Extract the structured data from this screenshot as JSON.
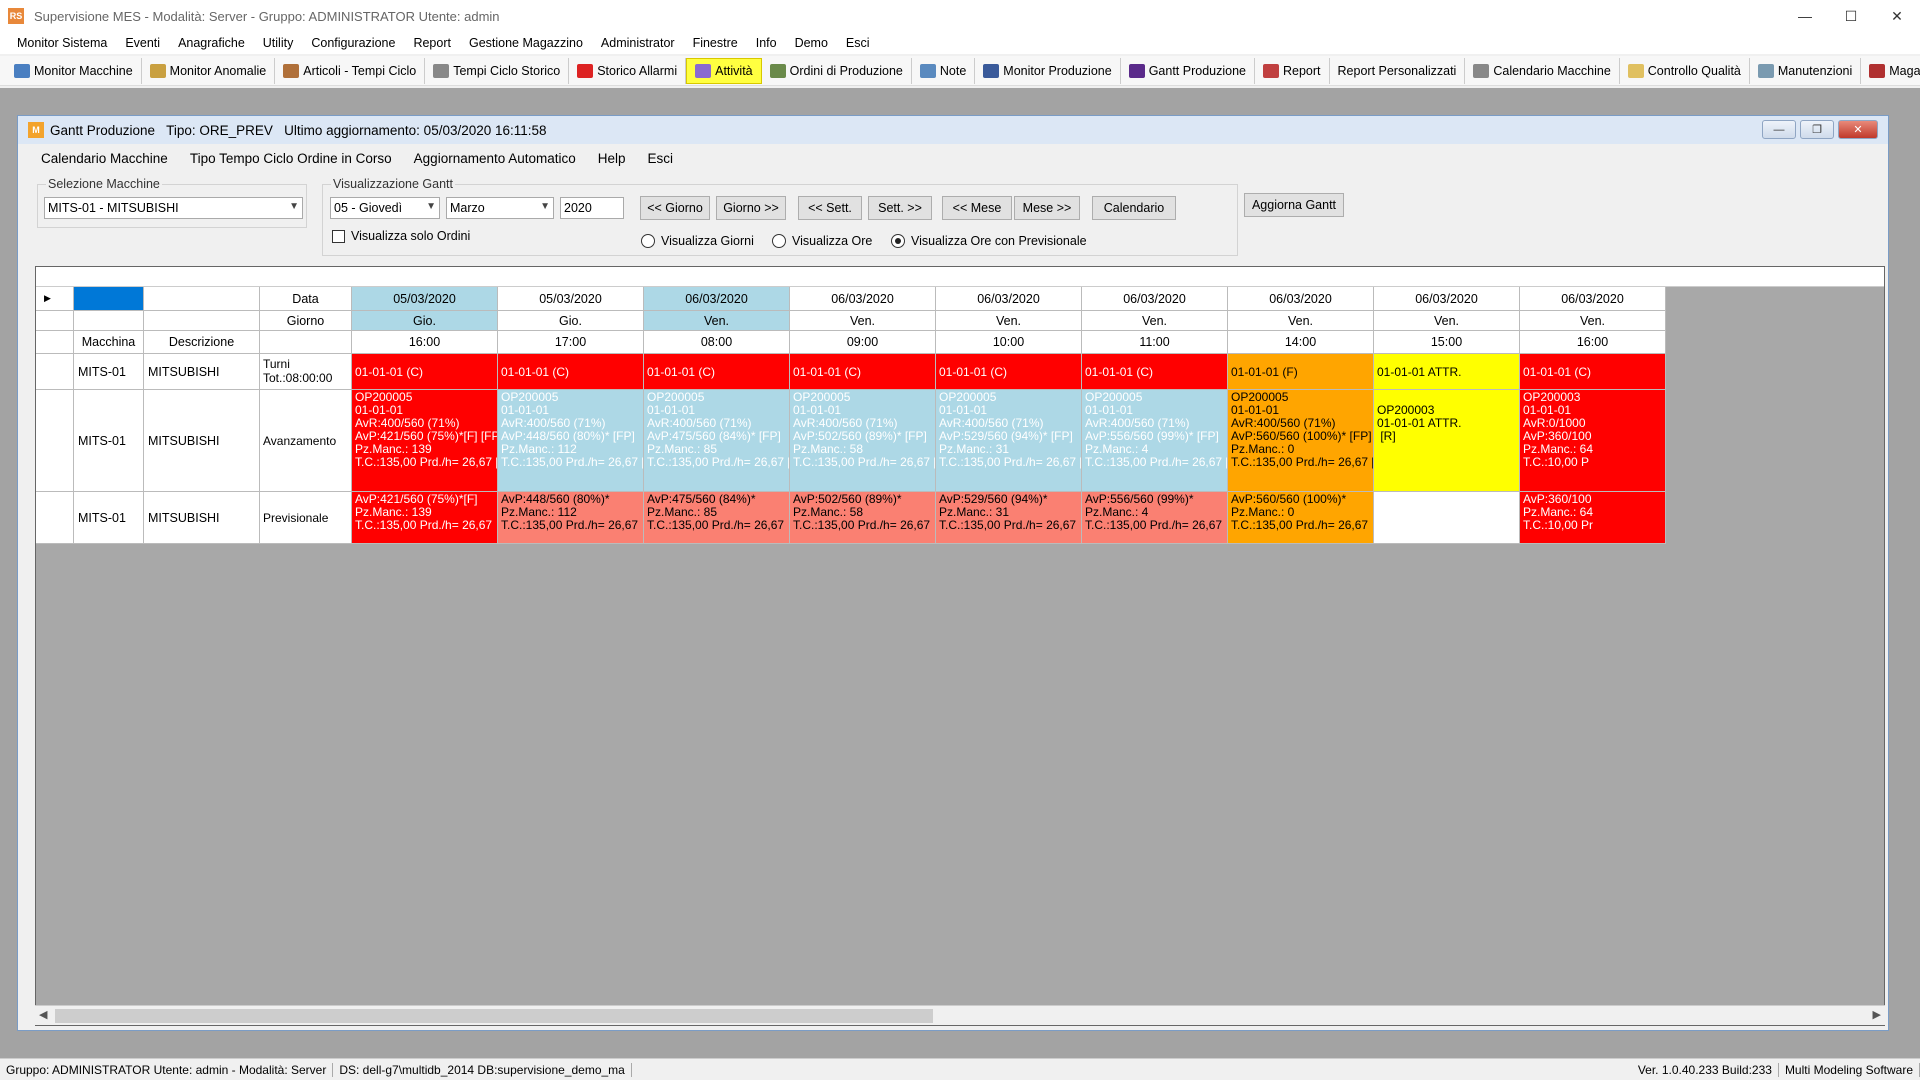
{
  "app": {
    "title": "Supervisione MES  -  Modalità: Server  -  Gruppo: ADMINISTRATOR  Utente: admin",
    "icon_text": "RS"
  },
  "menubar": [
    "Monitor Sistema",
    "Eventi",
    "Anagrafiche",
    "Utility",
    "Configurazione",
    "Report",
    "Gestione Magazzino",
    "Administrator",
    "Finestre",
    "Info",
    "Demo",
    "Esci"
  ],
  "toolbar": [
    {
      "label": "Monitor Macchine",
      "icon": "monitor-icon",
      "color": "#4a7fc1"
    },
    {
      "label": "Monitor Anomalie",
      "icon": "warning-car-icon",
      "color": "#c9a040"
    },
    {
      "label": "Articoli - Tempi Ciclo",
      "icon": "worker-icon",
      "color": "#b0703a"
    },
    {
      "label": "Tempi Ciclo Storico",
      "icon": "clock-icon",
      "color": "#888888"
    },
    {
      "label": "Storico Allarmi",
      "icon": "alarm-icon",
      "color": "#dd2222"
    },
    {
      "label": "Attività",
      "icon": "activity-icon",
      "color": "#8a6ad0",
      "active": true
    },
    {
      "label": "Ordini di Produzione",
      "icon": "orders-icon",
      "color": "#6a8a4a"
    },
    {
      "label": "Note",
      "icon": "note-icon",
      "color": "#5a8abf"
    },
    {
      "label": "Monitor Produzione",
      "icon": "screen-icon",
      "color": "#3a5a9a"
    },
    {
      "label": "Gantt Produzione",
      "icon": "gantt-icon",
      "color": "#5a2a8a"
    },
    {
      "label": "Report",
      "icon": "report-icon",
      "color": "#c04040"
    },
    {
      "label": "Report Personalizzati",
      "icon": "",
      "color": ""
    },
    {
      "label": "Calendario Macchine",
      "icon": "calendar-icon",
      "color": "#888888"
    },
    {
      "label": "Controllo Qualità",
      "icon": "clipboard-icon",
      "color": "#e0c060"
    },
    {
      "label": "Manutenzioni",
      "icon": "tools-icon",
      "color": "#7a9ab0"
    },
    {
      "label": "Magazzino",
      "icon": "warehouse-icon",
      "color": "#b03030"
    }
  ],
  "gantt_window": {
    "title": "Gantt Produzione   Tipo: ORE_PREV   Ultimo aggiornamento: 05/03/2020 16:11:58",
    "icon_text": "M",
    "menu": [
      "Calendario Macchine",
      "Tipo Tempo Ciclo Ordine in Corso",
      "Aggiornamento Automatico",
      "Help",
      "Esci"
    ],
    "selezione_label": "Selezione Macchine",
    "machine_value": "MITS-01 - MITSUBISHI",
    "visualizzazione_label": "Visualizzazione Gantt",
    "day_value": "05 - Giovedì",
    "month_value": "Marzo",
    "year_value": "2020",
    "nav_buttons": [
      "<< Giorno",
      "Giorno >>",
      "<< Sett.",
      "Sett. >>",
      "<< Mese",
      "Mese >>",
      "Calendario"
    ],
    "update_button": "Aggiorna Gantt",
    "only_orders_label": "Visualizza solo Ordini",
    "radios": [
      {
        "label": "Visualizza Giorni",
        "checked": false
      },
      {
        "label": "Visualizza Ore",
        "checked": false
      },
      {
        "label": "Visualizza Ore con Previsionale",
        "checked": true
      }
    ]
  },
  "grid": {
    "row_labels": {
      "data": "Data",
      "giorno": "Giorno",
      "ora": ""
    },
    "header_labels": {
      "macchina": "Macchina",
      "descrizione": "Descrizione"
    },
    "columns": [
      {
        "date": "05/03/2020",
        "day": "Gio.",
        "hour": "16:00",
        "highlight": true
      },
      {
        "date": "05/03/2020",
        "day": "Gio.",
        "hour": "17:00",
        "highlight": false
      },
      {
        "date": "06/03/2020",
        "day": "Ven.",
        "hour": "08:00",
        "highlight": true
      },
      {
        "date": "06/03/2020",
        "day": "Ven.",
        "hour": "09:00",
        "highlight": false
      },
      {
        "date": "06/03/2020",
        "day": "Ven.",
        "hour": "10:00",
        "highlight": false
      },
      {
        "date": "06/03/2020",
        "day": "Ven.",
        "hour": "11:00",
        "highlight": false
      },
      {
        "date": "06/03/2020",
        "day": "Ven.",
        "hour": "14:00",
        "highlight": false
      },
      {
        "date": "06/03/2020",
        "day": "Ven.",
        "hour": "15:00",
        "highlight": false
      },
      {
        "date": "06/03/2020",
        "day": "Ven.",
        "hour": "16:00",
        "highlight": false
      }
    ],
    "rows": [
      {
        "machine": "MITS-01",
        "desc": "MITSUBISHI",
        "type": "Turni\nTot.:08:00:00",
        "cells": [
          {
            "text": "01-01-01 (C)",
            "color": "red"
          },
          {
            "text": "01-01-01 (C)",
            "color": "red"
          },
          {
            "text": "01-01-01 (C)",
            "color": "red"
          },
          {
            "text": "01-01-01 (C)",
            "color": "red"
          },
          {
            "text": "01-01-01 (C)",
            "color": "red"
          },
          {
            "text": "01-01-01 (C)",
            "color": "red"
          },
          {
            "text": "01-01-01 (F)",
            "color": "orange"
          },
          {
            "text": "01-01-01 ATTR.",
            "color": "yellow"
          },
          {
            "text": "01-01-01 (C)",
            "color": "red"
          }
        ]
      },
      {
        "machine": "MITS-01",
        "desc": "MITSUBISHI",
        "type": "Avanzamento",
        "cells": [
          {
            "text": "OP200005\n01-01-01\nAvR:400/560 (71%)\nAvP:421/560 (75%)*[F] [FP]\nPz.Manc.: 139\nT.C.:135,00 Prd./h= 26,67 [R]",
            "color": "red"
          },
          {
            "text": "OP200005\n01-01-01\nAvR:400/560 (71%)\nAvP:448/560 (80%)* [FP]\nPz.Manc.: 112\nT.C.:135,00 Prd./h= 26,67 [R]",
            "color": "lblue"
          },
          {
            "text": "OP200005\n01-01-01\nAvR:400/560 (71%)\nAvP:475/560 (84%)* [FP]\nPz.Manc.: 85\nT.C.:135,00 Prd./h= 26,67 [R]",
            "color": "lblue"
          },
          {
            "text": "OP200005\n01-01-01\nAvR:400/560 (71%)\nAvP:502/560 (89%)* [FP]\nPz.Manc.: 58\nT.C.:135,00 Prd./h= 26,67 [R]",
            "color": "lblue"
          },
          {
            "text": "OP200005\n01-01-01\nAvR:400/560 (71%)\nAvP:529/560 (94%)* [FP]\nPz.Manc.: 31\nT.C.:135,00 Prd./h= 26,67 [R]",
            "color": "lblue"
          },
          {
            "text": "OP200005\n01-01-01\nAvR:400/560 (71%)\nAvP:556/560 (99%)* [FP]\nPz.Manc.: 4\nT.C.:135,00 Prd./h= 26,67 [R]",
            "color": "lblue"
          },
          {
            "text": "OP200005\n01-01-01\nAvR:400/560 (71%)\nAvP:560/560 (100%)* [FP]\nPz.Manc.: 0\nT.C.:135,00 Prd./h= 26,67 [R]",
            "color": "orange"
          },
          {
            "text": "\nOP200003\n01-01-01 ATTR.\n [R]",
            "color": "yellow"
          },
          {
            "text": "OP200003\n01-01-01\nAvR:0/1000\nAvP:360/100\nPz.Manc.: 64\nT.C.:10,00 P",
            "color": "red"
          }
        ]
      },
      {
        "machine": "MITS-01",
        "desc": "MITSUBISHI",
        "type": "Previsionale",
        "cells": [
          {
            "text": "AvP:421/560 (75%)*[F]\nPz.Manc.: 139\nT.C.:135,00 Prd./h= 26,67",
            "color": "red"
          },
          {
            "text": "AvP:448/560 (80%)*\nPz.Manc.: 112\nT.C.:135,00 Prd./h= 26,67",
            "color": "salmon"
          },
          {
            "text": "AvP:475/560 (84%)*\nPz.Manc.: 85\nT.C.:135,00 Prd./h= 26,67",
            "color": "salmon"
          },
          {
            "text": "AvP:502/560 (89%)*\nPz.Manc.: 58\nT.C.:135,00 Prd./h= 26,67",
            "color": "salmon"
          },
          {
            "text": "AvP:529/560 (94%)*\nPz.Manc.: 31\nT.C.:135,00 Prd./h= 26,67",
            "color": "salmon"
          },
          {
            "text": "AvP:556/560 (99%)*\nPz.Manc.: 4\nT.C.:135,00 Prd./h= 26,67",
            "color": "salmon"
          },
          {
            "text": "AvP:560/560 (100%)*\nPz.Manc.: 0\nT.C.:135,00 Prd./h= 26,67",
            "color": "orange"
          },
          {
            "text": "",
            "color": "white"
          },
          {
            "text": "AvP:360/100\nPz.Manc.: 64\nT.C.:10,00 Pr",
            "color": "red"
          }
        ]
      }
    ]
  },
  "statusbar": [
    "Gruppo: ADMINISTRATOR  Utente: admin  -  Modalità: Server",
    "DS: dell-g7\\multidb_2014 DB:supervisione_demo_ma",
    "Ver. 1.0.40.233 Build:233",
    "Multi Modeling Software"
  ]
}
